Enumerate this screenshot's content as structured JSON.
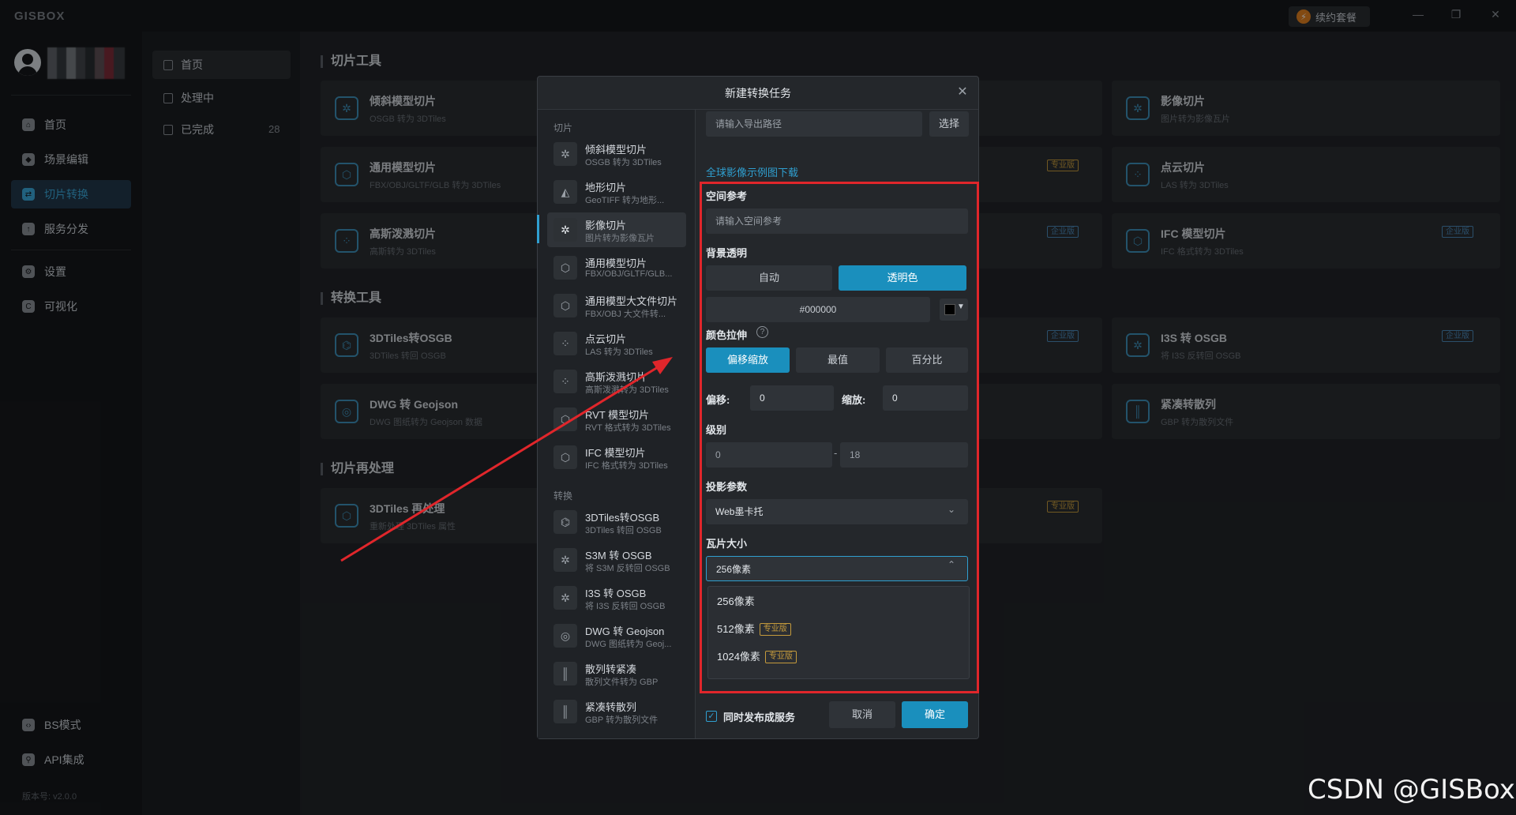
{
  "app": {
    "logo": "GISBOX",
    "renew_label": "续约套餐"
  },
  "window": {
    "minimize": "—",
    "restore": "❐",
    "close": "✕"
  },
  "sidebar": {
    "items": [
      {
        "label": "首页",
        "icon": "home-icon"
      },
      {
        "label": "场景编辑",
        "icon": "cube-icon"
      },
      {
        "label": "切片转换",
        "icon": "convert-icon"
      },
      {
        "label": "服务分发",
        "icon": "upload-icon"
      },
      {
        "label": "设置",
        "icon": "settings-icon"
      },
      {
        "label": "可视化",
        "icon": "visual-icon"
      },
      {
        "label": "BS模式",
        "icon": "code-icon"
      },
      {
        "label": "API集成",
        "icon": "api-icon"
      }
    ],
    "version": "版本号: v2.0.0"
  },
  "subnav": {
    "items": [
      {
        "label": "首页"
      },
      {
        "label": "处理中"
      },
      {
        "label": "已完成",
        "count": "28"
      }
    ]
  },
  "main": {
    "sections": [
      {
        "title": "切片工具"
      },
      {
        "title": "转换工具"
      },
      {
        "title": "切片再处理"
      }
    ],
    "cards": [
      {
        "title": "倾斜模型切片",
        "sub": "OSGB 转为 3DTiles"
      },
      {
        "title": "通用模型切片",
        "sub": "FBX/OBJ/GLTF/GLB 转为 3DTiles"
      },
      {
        "title": "高斯泼溅切片",
        "sub": "高斯转为 3DTiles"
      },
      {
        "title": "3DTiles转OSGB",
        "sub": "3DTiles 转回 OSGB"
      },
      {
        "title": "DWG 转 Geojson",
        "sub": "DWG 图纸转为 Geojson 数据"
      },
      {
        "title": "3DTiles 再处理",
        "sub": "重新处理 3DTiles 属性"
      },
      {
        "title": "影像切片",
        "sub": "图片转为影像瓦片"
      },
      {
        "title": "点云切片",
        "sub": "LAS 转为 3DTiles"
      },
      {
        "title": "IFC 模型切片",
        "sub": "IFC 格式转为 3DTiles"
      },
      {
        "title": "I3S 转 OSGB",
        "sub": "将 I3S 反转回 OSGB"
      },
      {
        "title": "紧凑转散列",
        "sub": "GBP 转为散列文件"
      }
    ],
    "badges": {
      "pro": "专业版",
      "ent": "企业版"
    }
  },
  "modal": {
    "title": "新建转换任务",
    "groups": [
      "切片",
      "转换"
    ],
    "slice_items": [
      {
        "title": "倾斜模型切片",
        "sub": "OSGB 转为 3DTiles"
      },
      {
        "title": "地形切片",
        "sub": "GeoTIFF 转为地形..."
      },
      {
        "title": "影像切片",
        "sub": "图片转为影像瓦片"
      },
      {
        "title": "通用模型切片",
        "sub": "FBX/OBJ/GLTF/GLB..."
      },
      {
        "title": "通用模型大文件切片",
        "sub": "FBX/OBJ 大文件转..."
      },
      {
        "title": "点云切片",
        "sub": "LAS 转为 3DTiles"
      },
      {
        "title": "高斯泼溅切片",
        "sub": "高斯泼溅转为 3DTiles"
      },
      {
        "title": "RVT 模型切片",
        "sub": "RVT 格式转为 3DTiles"
      },
      {
        "title": "IFC 模型切片",
        "sub": "IFC 格式转为 3DTiles"
      }
    ],
    "convert_items": [
      {
        "title": "3DTiles转OSGB",
        "sub": "3DTiles 转回 OSGB"
      },
      {
        "title": "S3M 转 OSGB",
        "sub": "将 S3M 反转回 OSGB"
      },
      {
        "title": "I3S 转 OSGB",
        "sub": "将 I3S 反转回 OSGB"
      },
      {
        "title": "DWG 转 Geojson",
        "sub": "DWG 图纸转为 Geoj..."
      },
      {
        "title": "散列转紧凑",
        "sub": "散列文件转为 GBP"
      },
      {
        "title": "紧凑转散列",
        "sub": "GBP 转为散列文件"
      }
    ],
    "form": {
      "export_placeholder": "请输入导出路径",
      "choose_label": "选择",
      "sample_link": "全球影像示例图下载",
      "spatial_ref_label": "空间参考",
      "spatial_ref_placeholder": "请输入空间参考",
      "bg_transparent_label": "背景透明",
      "bg_options": [
        "自动",
        "透明色"
      ],
      "bg_color_value": "#000000",
      "color_stretch_label": "颜色拉伸",
      "stretch_options": [
        "偏移缩放",
        "最值",
        "百分比"
      ],
      "offset_label": "偏移:",
      "offset_value": "0",
      "scale_label": "缩放:",
      "scale_value": "0",
      "level_label": "级别",
      "level_min": "0",
      "level_sep": "-",
      "level_max": "18",
      "projection_label": "投影参数",
      "projection_value": "Web墨卡托",
      "tile_size_label": "瓦片大小",
      "tile_size_value": "256像素",
      "tile_options": [
        {
          "label": "256像素",
          "tag": ""
        },
        {
          "label": "512像素",
          "tag": "专业版"
        },
        {
          "label": "1024像素",
          "tag": "专业版"
        }
      ],
      "publish_label": "同时发布成服务",
      "cancel_label": "取消",
      "confirm_label": "确定"
    }
  },
  "watermark": "CSDN @GISBox",
  "colors": {
    "accent": "#1a8fbd",
    "highlight_box": "#e0262b"
  }
}
